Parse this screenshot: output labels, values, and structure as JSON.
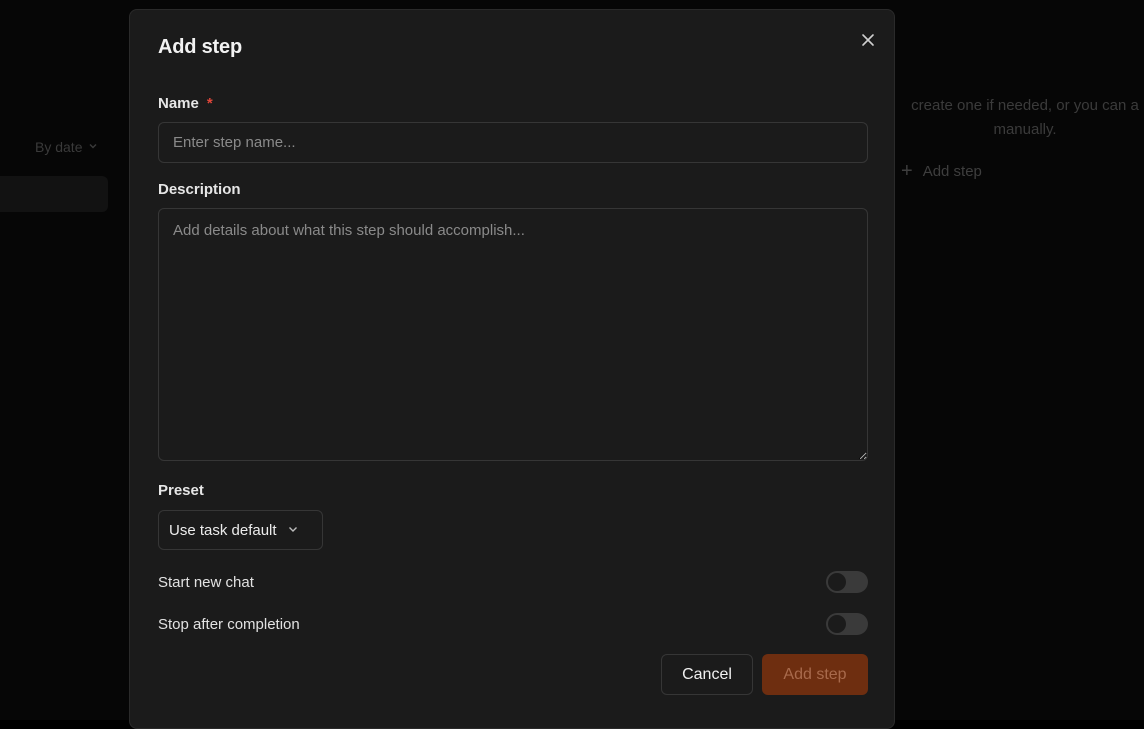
{
  "background": {
    "sort_label": "By date",
    "hint_line1": "create one if needed, or you can a",
    "hint_line2": "manually.",
    "add_step_label": "Add step"
  },
  "modal": {
    "title": "Add step",
    "name": {
      "label": "Name",
      "required_mark": "*",
      "value": "",
      "placeholder": "Enter step name..."
    },
    "description": {
      "label": "Description",
      "value": "",
      "placeholder": "Add details about what this step should accomplish..."
    },
    "preset": {
      "label": "Preset",
      "selected": "Use task default"
    },
    "toggles": {
      "start_new_chat": {
        "label": "Start new chat",
        "on": false
      },
      "stop_after_completion": {
        "label": "Stop after completion",
        "on": false
      }
    },
    "buttons": {
      "cancel": "Cancel",
      "submit": "Add step"
    }
  },
  "colors": {
    "accent_disabled": "#6e2e10",
    "required": "#e0463a"
  }
}
